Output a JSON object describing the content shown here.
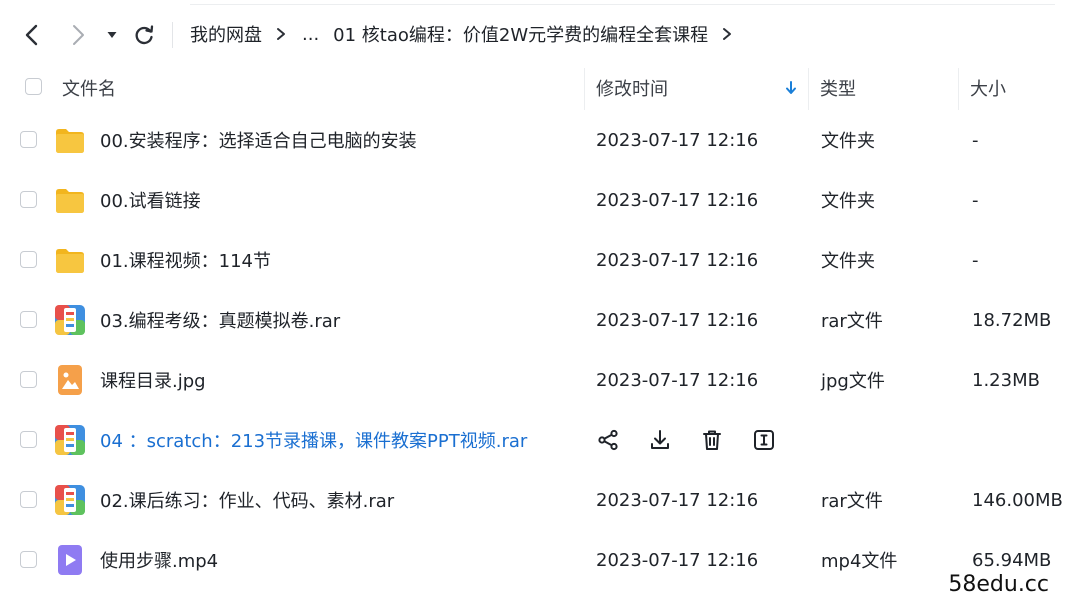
{
  "breadcrumb": {
    "root": "我的网盘",
    "ellipsis": "...",
    "current": "01 核tao编程：价值2W元学费的编程全套课程"
  },
  "columns": {
    "name": "文件名",
    "modified": "修改时间",
    "type": "类型",
    "size": "大小"
  },
  "sort": {
    "column": "modified",
    "direction": "descending",
    "indicator_color": "#1a7fd8"
  },
  "files": [
    {
      "name": "00.安装程序：选择适合自己电脑的安装",
      "modified": "2023-07-17 12:16",
      "type": "文件夹",
      "size": "-",
      "icon": "folder-icon"
    },
    {
      "name": "00.试看链接",
      "modified": "2023-07-17 12:16",
      "type": "文件夹",
      "size": "-",
      "icon": "folder-icon"
    },
    {
      "name": "01.课程视频：114节",
      "modified": "2023-07-17 12:16",
      "type": "文件夹",
      "size": "-",
      "icon": "folder-icon"
    },
    {
      "name": "03.编程考级：真题模拟卷.rar",
      "modified": "2023-07-17 12:16",
      "type": "rar文件",
      "size": "18.72MB",
      "icon": "archive-icon"
    },
    {
      "name": "课程目录.jpg",
      "modified": "2023-07-17 12:16",
      "type": "jpg文件",
      "size": "1.23MB",
      "icon": "image-file-icon"
    },
    {
      "name": "04 ：scratch：213节录播课，课件教案PPT视频.rar",
      "modified": "",
      "type": "",
      "size": "",
      "icon": "archive-icon",
      "hovered": true
    },
    {
      "name": "02.课后练习：作业、代码、素材.rar",
      "modified": "2023-07-17 12:16",
      "type": "rar文件",
      "size": "146.00MB",
      "icon": "archive-icon"
    },
    {
      "name": "使用步骤.mp4",
      "modified": "2023-07-17 12:16",
      "type": "mp4文件",
      "size": "65.94MB",
      "icon": "video-file-icon"
    }
  ],
  "row_actions": [
    "share-icon",
    "download-icon",
    "delete-icon",
    "rename-icon"
  ],
  "watermark": "58edu.cc",
  "colors": {
    "folder": "#f7c640",
    "archive_red": "#e8504a",
    "archive_blue": "#3f8fe0",
    "archive_green": "#5fc25e",
    "archive_yellow": "#f5c542",
    "image_file": "#f5a04a",
    "video_file": "#8f7bf2",
    "hover_text": "#1a6fd1"
  }
}
